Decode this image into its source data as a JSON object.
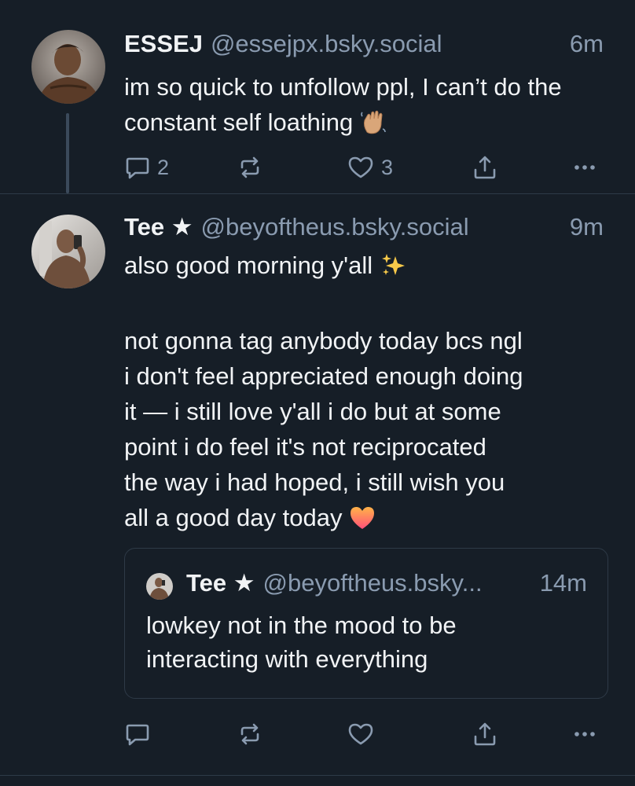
{
  "posts": [
    {
      "author_name": "ESSEJ",
      "handle": "@essejpx.bsky.social",
      "time": "6m",
      "text": "im so quick to unfollow ppl, I can’t do the constant self loathing",
      "reply_count": "2",
      "like_count": "3"
    },
    {
      "author_name": "Tee ★",
      "handle": "@beyoftheus.bsky.social",
      "time": "9m",
      "text_line1": "also good morning y'all",
      "text_body": "not gonna tag anybody today bcs ngl\ni don't feel appreciated enough doing\nit — i still love y'all i do but at some\npoint i do feel it's not reciprocated\nthe way i had hoped, i still wish you\nall a good day today",
      "quote": {
        "author_name": "Tee ★",
        "handle": "@beyoftheus.bsky...",
        "time": "14m",
        "text": "lowkey not in the mood to be\ninteracting with everything"
      }
    }
  ],
  "icons": [
    "reply-icon",
    "repost-icon",
    "like-icon",
    "share-icon",
    "more-icon"
  ],
  "colors": {
    "background": "#161e27",
    "text": "#f1f3f5",
    "muted": "#8a9bb0",
    "divider": "#2e3a47"
  }
}
